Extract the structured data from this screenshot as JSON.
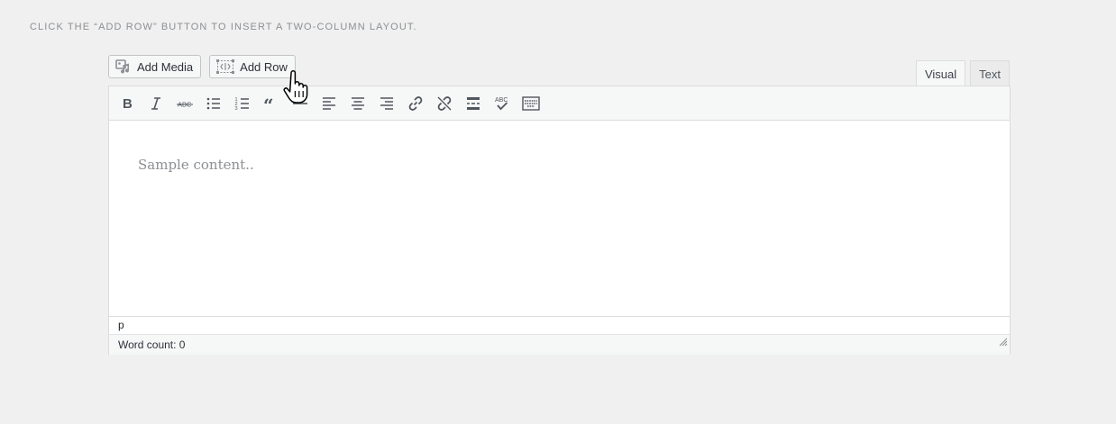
{
  "instruction": "Click the “Add Row” button to insert a two-column layout.",
  "media_buttons": {
    "add_media": "Add Media",
    "add_row": "Add Row"
  },
  "tabs": {
    "visual": "Visual",
    "text": "Text"
  },
  "toolbar": {
    "items": [
      "bold-icon",
      "italic-icon",
      "strikethrough-icon",
      "bullet-list-icon",
      "numbered-list-icon",
      "blockquote-icon",
      "horizontal-line-icon",
      "align-left-icon",
      "align-center-icon",
      "align-right-icon",
      "link-icon",
      "unlink-icon",
      "read-more-icon",
      "spellcheck-icon",
      "toolbar-toggle-icon"
    ]
  },
  "editor": {
    "placeholder": "Sample content.."
  },
  "path": "p",
  "status": {
    "word_count": "Word count: 0"
  }
}
